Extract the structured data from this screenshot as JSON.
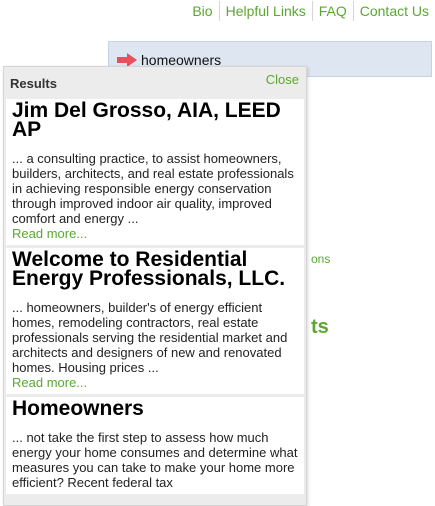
{
  "nav": {
    "items": [
      "Bio",
      "Helpful Links",
      "FAQ",
      "Contact Us"
    ]
  },
  "search": {
    "term": "homeowners"
  },
  "background": {
    "fragment_1": "ons",
    "fragment_2": "ts"
  },
  "results": {
    "title": "Results",
    "close_label": "Close",
    "items": [
      {
        "title": "Jim Del Grosso, AIA, LEED AP",
        "snippet": "... a consulting practice, to assist homeowners, builders, architects, and real estate professionals in achieving responsible energy conservation through improved indoor air quality, improved comfort and energy ...",
        "read_more": "Read more..."
      },
      {
        "title": "Welcome to Residential Energy Professionals, LLC.",
        "snippet": "... homeowners, builder's of energy efficient homes, remodeling contractors, real estate professionals serving the residential market and architects and designers of new and renovated homes. Housing prices ...",
        "read_more": "Read more..."
      },
      {
        "title": "Homeowners",
        "snippet": "... not take the first step to assess how much energy your home consumes and determine what measures you can take to make your home more efficient? Recent federal tax",
        "read_more": ""
      }
    ]
  },
  "colors": {
    "accent_green": "#5aa832",
    "search_bg": "#dde6f1",
    "arrow_red": "#e8505b"
  },
  "icons": {
    "search_arrow": "arrow-right-icon"
  }
}
